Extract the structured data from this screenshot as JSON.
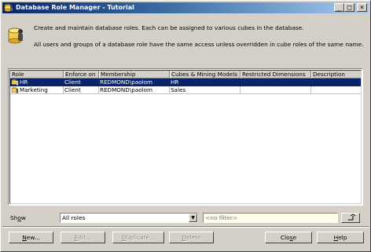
{
  "window": {
    "title": "Database Role Manager - Tutorial",
    "caption_buttons": {
      "minimize": "_",
      "maximize": "□",
      "close": "×"
    }
  },
  "intro": {
    "line1": "Create and maintain database roles. Each can be assigned to various cubes in the database.",
    "line2": "All users and groups of a database role have the same access unless overridden in cube roles of the same name."
  },
  "table": {
    "columns": [
      "Role",
      "Enforce on",
      "Membership",
      "Cubes & Mining Models",
      "Restricted Dimensions",
      "Description"
    ],
    "rows": [
      {
        "role": "HR",
        "enforce_on": "Client",
        "membership": "REDMOND\\paolom",
        "cubes": "HR",
        "restricted": "",
        "description": "",
        "selected": true
      },
      {
        "role": "Marketing",
        "enforce_on": "Client",
        "membership": "REDMOND\\paolom",
        "cubes": "Sales",
        "restricted": "",
        "description": "",
        "selected": false
      }
    ]
  },
  "filter": {
    "show_label_pre": "Sh",
    "show_label_mn": "o",
    "show_label_post": "w",
    "show_value": "All roles",
    "filter_placeholder": "<no filter>"
  },
  "buttons": {
    "new": {
      "pre": "",
      "mn": "N",
      "post": "ew..."
    },
    "edit": {
      "pre": "",
      "mn": "E",
      "post": "dit..."
    },
    "duplicate": {
      "pre": "",
      "mn": "D",
      "post": "uplicate..."
    },
    "delete": {
      "pre": "",
      "mn": "D",
      "post": "elete"
    },
    "close": {
      "pre": "Clo",
      "mn": "s",
      "post": "e"
    },
    "help": {
      "pre": "",
      "mn": "H",
      "post": "elp"
    }
  },
  "icons": {
    "title": "database-role-icon",
    "intro": "database-role-large-icon",
    "row": "role-icon",
    "filter_button": "filter-icon"
  },
  "colors": {
    "titlebar_start": "#0a246a",
    "titlebar_end": "#a6caf0",
    "selection": "#0a246a",
    "filter_bg": "#fffbea"
  }
}
